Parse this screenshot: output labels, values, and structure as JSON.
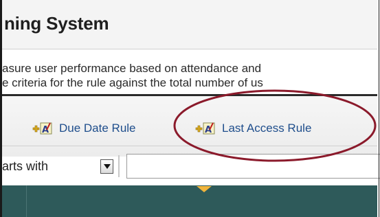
{
  "header": {
    "title": "ning System"
  },
  "description": {
    "line1": "asure user performance based on attendance and",
    "line2": "e criteria for the rule against the total number of us"
  },
  "toolbar": {
    "due_date_label": "Due Date Rule",
    "last_access_label": "Last Access Rule",
    "icon": "add-rule-icon"
  },
  "filter": {
    "operator_label": "arts with",
    "search_value": ""
  },
  "colors": {
    "link": "#1f4e8c",
    "table_header": "#2e5a5a",
    "sort_caret": "#f0b43c",
    "highlight": "#8b1a2b"
  }
}
